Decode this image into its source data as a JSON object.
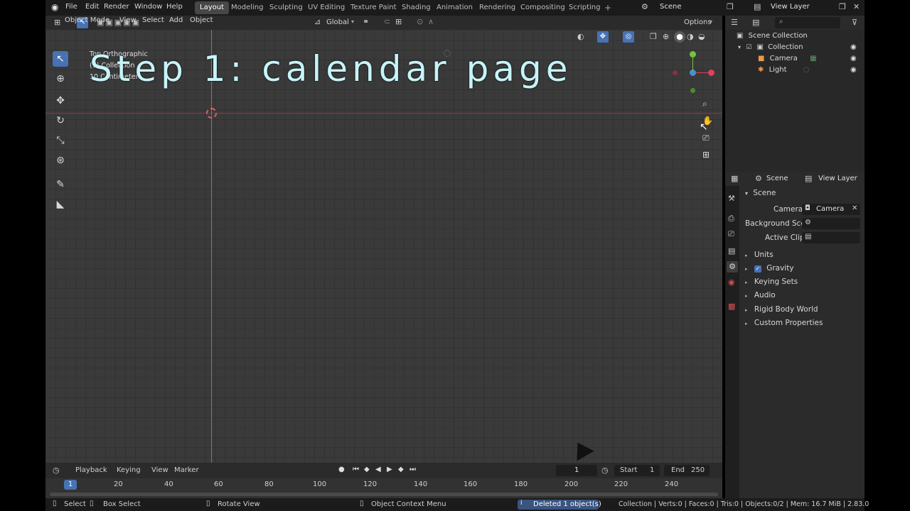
{
  "overlay_caption": "Step 1: calendar page",
  "menubar": {
    "items": [
      "File",
      "Edit",
      "Render",
      "Window",
      "Help"
    ],
    "workspaces": [
      "Layout",
      "Modeling",
      "Sculpting",
      "UV Editing",
      "Texture Paint",
      "Shading",
      "Animation",
      "Rendering",
      "Compositing",
      "Scripting"
    ],
    "active_workspace": "Layout",
    "scene": "Scene",
    "view_layer": "View Layer"
  },
  "viewport_header": {
    "mode": "Object Mode",
    "view": "View",
    "select": "Select",
    "add": "Add",
    "object": "Object",
    "orientation": "Global",
    "options": "Options"
  },
  "viewport": {
    "view_name": "Top Orthographic",
    "collection_info": "(1) Collection",
    "scale_info": "10 Centimeters"
  },
  "outliner": {
    "root": "Scene Collection",
    "collection": "Collection",
    "items": [
      "Camera",
      "Light"
    ]
  },
  "properties": {
    "tabs": [
      "Scene",
      "View Layer"
    ],
    "section": "Scene",
    "camera_label": "Camera",
    "camera_value": "Camera",
    "background_label": "Background Sce...",
    "clip_label": "Active Clip",
    "panels": [
      "Units",
      "Gravity",
      "Keying Sets",
      "Audio",
      "Rigid Body World",
      "Custom Properties"
    ],
    "gravity_checked": true
  },
  "timeline": {
    "playback": "Playback",
    "keying": "Keying",
    "view": "View",
    "marker": "Marker",
    "current_frame": "1",
    "start_label": "Start",
    "start_value": "1",
    "end_label": "End",
    "end_value": "250",
    "ticks": [
      "1",
      "20",
      "40",
      "60",
      "80",
      "100",
      "120",
      "140",
      "160",
      "180",
      "200",
      "220",
      "240"
    ]
  },
  "statusbar": {
    "select": "Select",
    "box_select": "Box Select",
    "rotate_view": "Rotate View",
    "context_menu": "Object Context Menu",
    "message": "Deleted 1 object(s)",
    "stats": "Collection | Verts:0 | Faces:0 | Tris:0 | Objects:0/2 | Mem: 16.7 MiB | 2.83.0"
  },
  "colors": {
    "accent": "#4772b3",
    "x_axis": "#e0405a",
    "y_axis": "#74c43a",
    "caption": "#c6f4f8"
  }
}
